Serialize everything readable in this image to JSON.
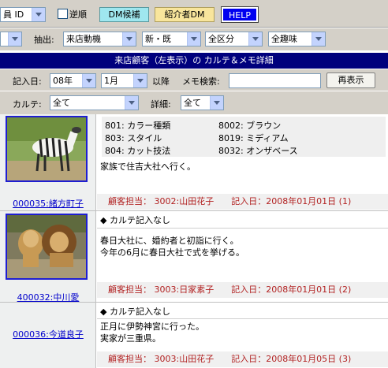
{
  "toolbar": {
    "id_select": "員 ID",
    "reverse_label": "逆順",
    "dm_candidate": "DM候補",
    "referrer_dm": "紹介者DM",
    "help": "HELP"
  },
  "filters_top": {
    "extract_label": "抽出:",
    "visit_motive": "来店動機",
    "new_existing": "新・既",
    "all_segments": "全区分",
    "all_hobbies": "全趣味"
  },
  "header": {
    "title": "来店顧客（左表示）の カルテ＆メモ詳細"
  },
  "filters": {
    "entry_date_label": "記入日:",
    "year": "08年",
    "month": "1月",
    "since_label": "以降",
    "memo_search_label": "メモ検索:",
    "memo_search_value": "",
    "redisplay": "再表示",
    "karte_label": "カルテ:",
    "karte_value": "全て",
    "detail_label": "詳細:",
    "detail_value": "全て"
  },
  "records": [
    {
      "customer": "000035:緒方町子",
      "photo": "zebra-horse-photo",
      "karte_items": [
        "801: カラー種類",
        "8002: ブラウン",
        "803: スタイル",
        "8019: ミディアム",
        "804: カット技法",
        "8032: オンザベース"
      ],
      "no_karte": "",
      "memo": [
        "家族で住吉大社へ行く。"
      ],
      "staff": "顧客担当： 3002:山田花子　　記入日：2008年01月01日 (1)"
    },
    {
      "customer": "400032:中川愛",
      "photo": "lions-photo",
      "karte_items": [],
      "no_karte": "◆ カルテ記入なし",
      "memo": [
        "春日大社に、婚約者と初詣に行く。",
        "今年の6月に春日大社で式を挙げる。"
      ],
      "staff": "顧客担当： 3003:日家素子　　記入日：2008年01月01日 (2)"
    },
    {
      "customer": "000036:今道良子",
      "photo": "",
      "karte_items": [],
      "no_karte": "◆ カルテ記入なし",
      "memo": [
        "正月に伊勢神宮に行った。",
        "実家が三重県。"
      ],
      "staff": "顧客担当： 3003:山田花子　　記入日：2008年01月05日 (3)"
    }
  ]
}
